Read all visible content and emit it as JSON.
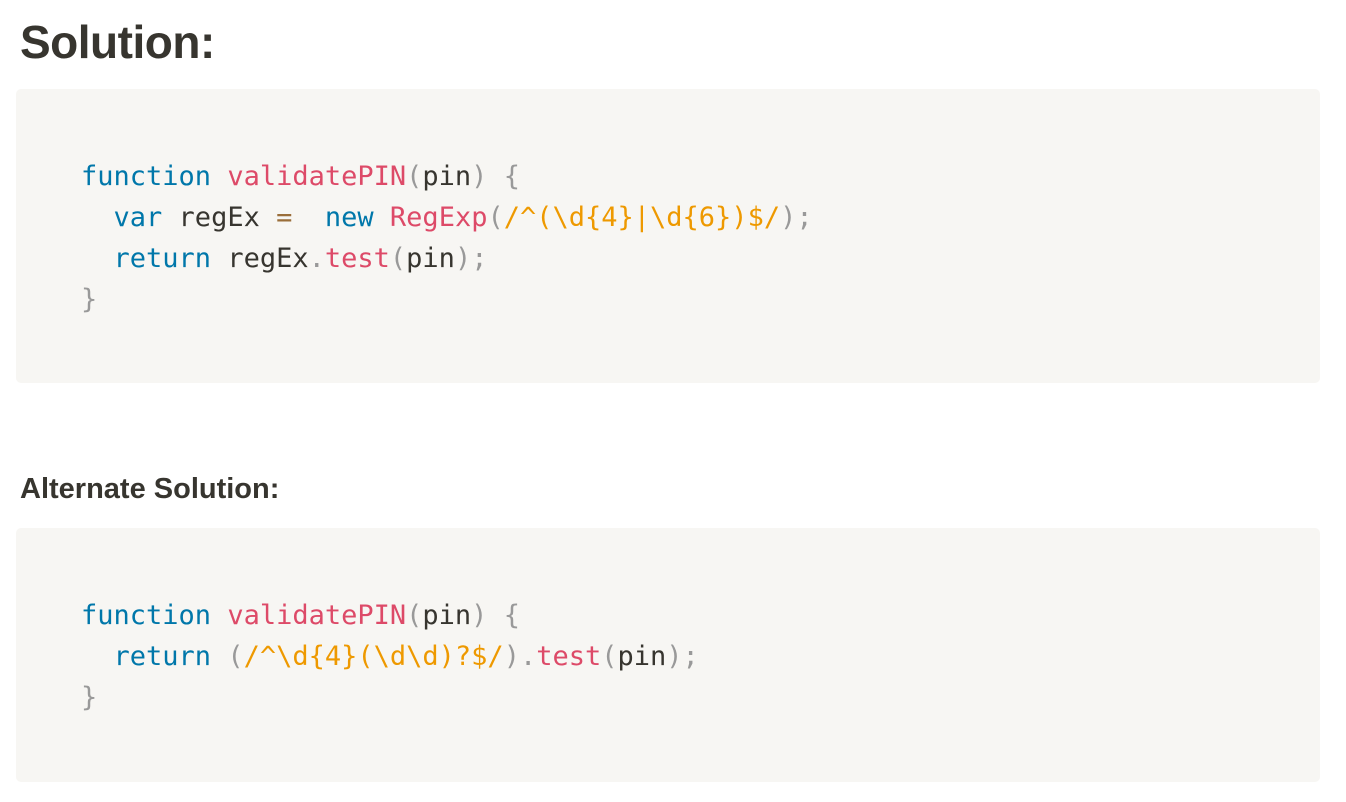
{
  "headings": {
    "solution": "Solution:",
    "alternate": "Alternate Solution:"
  },
  "code_blocks": [
    {
      "lines": [
        [
          {
            "t": "function",
            "c": "kw"
          },
          {
            "t": " ",
            "c": "tx"
          },
          {
            "t": "validatePIN",
            "c": "fn"
          },
          {
            "t": "(",
            "c": "pn"
          },
          {
            "t": "pin",
            "c": "tx"
          },
          {
            "t": ")",
            "c": "pn"
          },
          {
            "t": " ",
            "c": "tx"
          },
          {
            "t": "{",
            "c": "pn"
          }
        ],
        [
          {
            "t": "  ",
            "c": "tx"
          },
          {
            "t": "var",
            "c": "kw"
          },
          {
            "t": " regEx ",
            "c": "tx"
          },
          {
            "t": "=",
            "c": "op"
          },
          {
            "t": "  ",
            "c": "tx"
          },
          {
            "t": "new",
            "c": "kw"
          },
          {
            "t": " ",
            "c": "tx"
          },
          {
            "t": "RegExp",
            "c": "fn"
          },
          {
            "t": "(",
            "c": "pn"
          },
          {
            "t": "/^(\\d{4}|\\d{6})$/",
            "c": "rx"
          },
          {
            "t": ");",
            "c": "pn"
          }
        ],
        [
          {
            "t": "  ",
            "c": "tx"
          },
          {
            "t": "return",
            "c": "kw"
          },
          {
            "t": " regEx",
            "c": "tx"
          },
          {
            "t": ".",
            "c": "pn"
          },
          {
            "t": "test",
            "c": "fn"
          },
          {
            "t": "(",
            "c": "pn"
          },
          {
            "t": "pin",
            "c": "tx"
          },
          {
            "t": ");",
            "c": "pn"
          }
        ],
        [
          {
            "t": "}",
            "c": "pn"
          }
        ]
      ]
    },
    {
      "lines": [
        [
          {
            "t": "function",
            "c": "kw"
          },
          {
            "t": " ",
            "c": "tx"
          },
          {
            "t": "validatePIN",
            "c": "fn"
          },
          {
            "t": "(",
            "c": "pn"
          },
          {
            "t": "pin",
            "c": "tx"
          },
          {
            "t": ")",
            "c": "pn"
          },
          {
            "t": " ",
            "c": "tx"
          },
          {
            "t": "{",
            "c": "pn"
          }
        ],
        [
          {
            "t": "  ",
            "c": "tx"
          },
          {
            "t": "return",
            "c": "kw"
          },
          {
            "t": " ",
            "c": "tx"
          },
          {
            "t": "(",
            "c": "pn"
          },
          {
            "t": "/^\\d{4}(\\d\\d)?$/",
            "c": "rx"
          },
          {
            "t": ").",
            "c": "pn"
          },
          {
            "t": "test",
            "c": "fn"
          },
          {
            "t": "(",
            "c": "pn"
          },
          {
            "t": "pin",
            "c": "tx"
          },
          {
            "t": ");",
            "c": "pn"
          }
        ],
        [
          {
            "t": "}",
            "c": "pn"
          }
        ]
      ]
    }
  ],
  "colors": {
    "keyword": "#0077aa",
    "function": "#dd4a68",
    "regex": "#ee9900",
    "operator": "#9a6e3a",
    "punctuation": "#999999",
    "text": "#37352f",
    "code_background": "#f7f6f3"
  }
}
